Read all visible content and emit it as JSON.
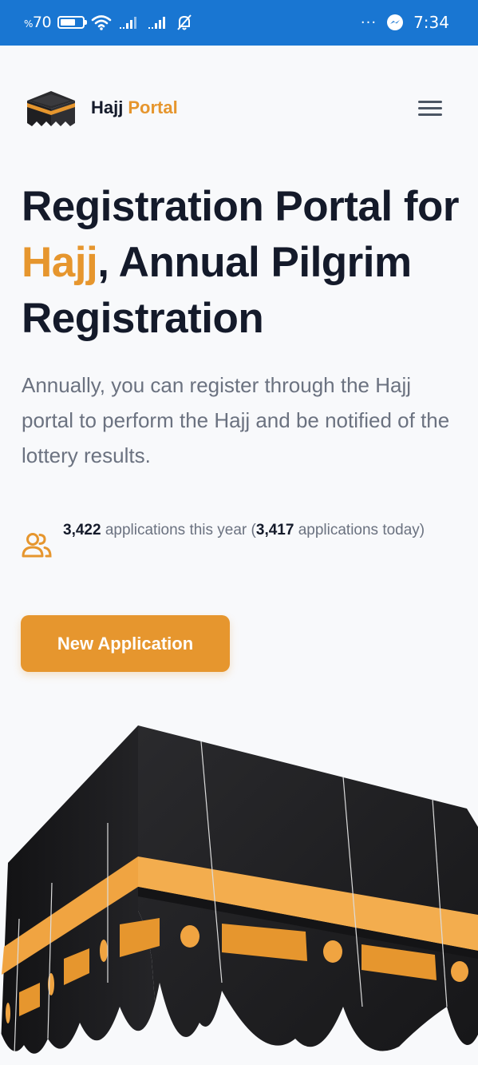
{
  "status_bar": {
    "battery_prefix": "%",
    "battery_level": "70",
    "battery_fraction": 0.7,
    "time": "7:34",
    "overflow": "···",
    "icons": [
      "battery-icon",
      "wifi-icon",
      "signal-icon",
      "signal-icon",
      "bell-off-icon",
      "messenger-icon"
    ]
  },
  "header": {
    "brand_part1": "Hajj",
    "brand_part2": "Portal",
    "menu_icon": "hamburger-menu-icon"
  },
  "hero": {
    "title_part1": "Registration Portal for",
    "title_accent": "Hajj",
    "title_part2": ", Annual Pilgrim Registration",
    "description": "Annually, you can register through the Hajj portal to perform the Hajj and be notified of the lottery results."
  },
  "stats": {
    "icon": "users-icon",
    "count_year": "3,422",
    "label_year": " applications this year (",
    "count_today": "3,417",
    "label_today": " applications today)"
  },
  "cta": {
    "label": "New Application"
  },
  "colors": {
    "accent": "#e6962e",
    "status_bar": "#1976d2",
    "text": "#141a2a",
    "muted": "#6b7280",
    "kaaba": "#1b1b1d"
  }
}
